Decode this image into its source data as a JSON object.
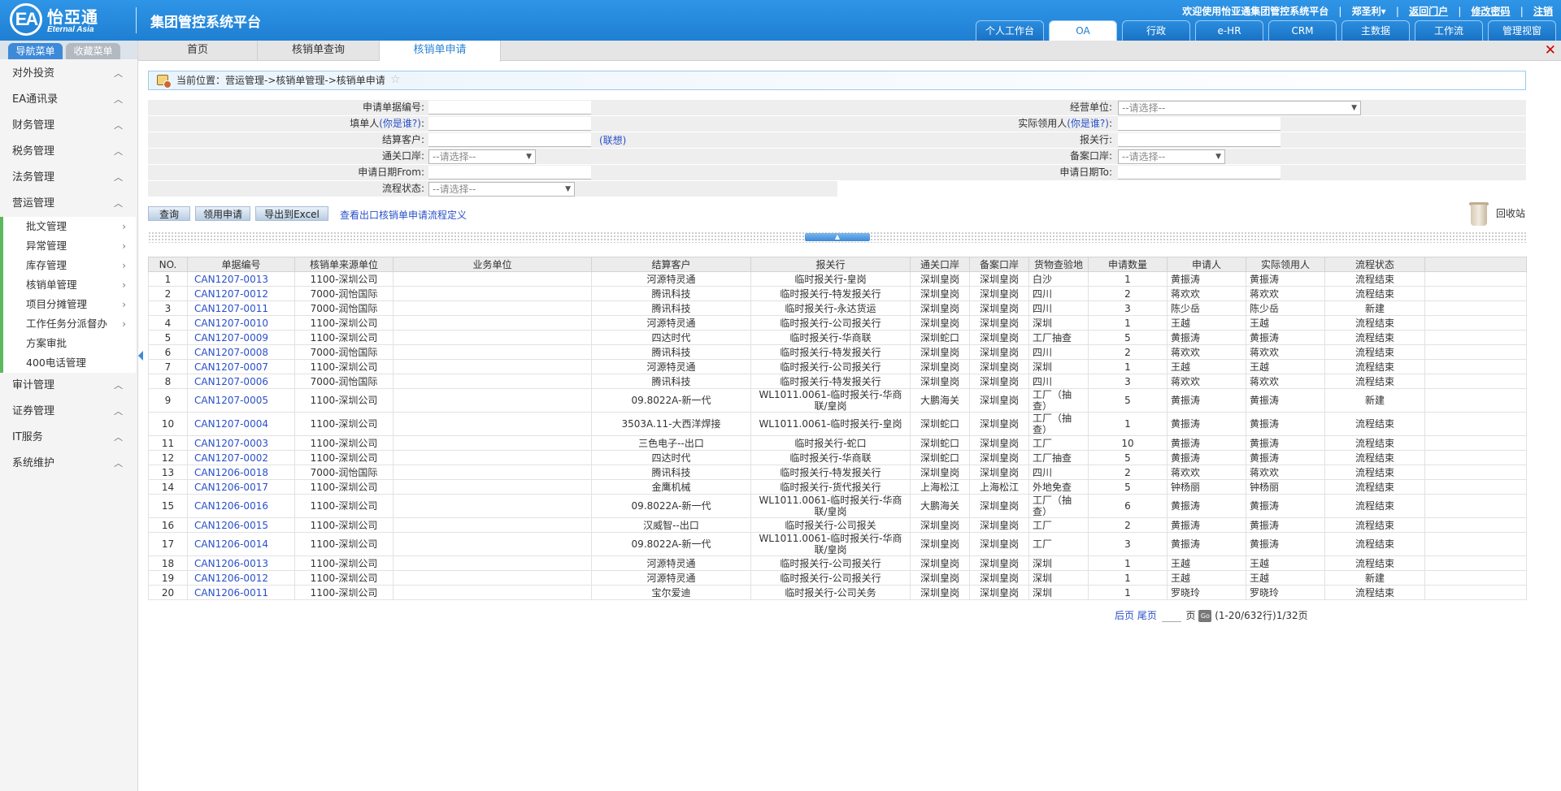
{
  "header": {
    "logo_cn": "怡亞通",
    "logo_en": "Eternal Asia",
    "logo_mark": "EA",
    "system_title": "集团管控系统平台",
    "welcome_text": "欢迎使用怡亚通集团管控系统平台",
    "user_name": "郑圣利▾",
    "links": [
      "返回门户",
      "修改密码",
      "注销"
    ],
    "module_tabs": [
      "个人工作台",
      "OA",
      "行政",
      "e-HR",
      "CRM",
      "主数据",
      "工作流",
      "管理视窗"
    ],
    "active_module": "OA"
  },
  "sidebar": {
    "tabs": [
      "导航菜单",
      "收藏菜单"
    ],
    "groups_top": [
      "对外投资",
      "EA通讯录",
      "财务管理",
      "税务管理",
      "法务管理",
      "营运管理"
    ],
    "sub_items": [
      "批文管理",
      "异常管理",
      "库存管理",
      "核销单管理",
      "项目分摊管理",
      "工作任务分派督办",
      "方案审批",
      "400电话管理"
    ],
    "groups_bottom": [
      "审计管理",
      "证券管理",
      "IT服务",
      "系统维护"
    ]
  },
  "page_tabs": [
    "首页",
    "核销单查询",
    "核销单申请"
  ],
  "breadcrumb": "当前位置：营运管理->核销单管理->核销单申请",
  "form": {
    "left_labels": [
      "申请单据编号:",
      "填单人",
      "结算客户:",
      "通关口岸:",
      "申请日期From:",
      "流程状态:"
    ],
    "who_label": "(你是谁?)",
    "colon": ":",
    "right_labels": [
      "经营单位:",
      "实际领用人",
      "报关行:",
      "备案口岸:",
      "申请日期To:"
    ],
    "select_placeholder": "--请选择--",
    "assoc_link": "(联想)"
  },
  "actions": {
    "query": "查询",
    "apply": "领用申请",
    "export": "导出到Excel",
    "flow_link": "查看出口核销单申请流程定义",
    "recycle": "回收站"
  },
  "table": {
    "headers": [
      "NO.",
      "单据编号",
      "核销单来源单位",
      "业务单位",
      "结算客户",
      "报关行",
      "通关口岸",
      "备案口岸",
      "货物查验地",
      "申请数量",
      "申请人",
      "实际领用人",
      "流程状态",
      ""
    ],
    "rows": [
      [
        "1",
        "CAN1207-0013",
        "1100-深圳公司",
        "",
        "河源特灵通",
        "临时报关行-皇岗",
        "深圳皇岗",
        "深圳皇岗",
        "白沙",
        "1",
        "黄振涛",
        "黄振涛",
        "流程结束",
        ""
      ],
      [
        "2",
        "CAN1207-0012",
        "7000-润怡国际",
        "",
        "腾讯科技",
        "临时报关行-特发报关行",
        "深圳皇岗",
        "深圳皇岗",
        "四川",
        "2",
        "蒋欢欢",
        "蒋欢欢",
        "流程结束",
        ""
      ],
      [
        "3",
        "CAN1207-0011",
        "7000-润怡国际",
        "",
        "腾讯科技",
        "临时报关行-永达货运",
        "深圳皇岗",
        "深圳皇岗",
        "四川",
        "3",
        "陈少岳",
        "陈少岳",
        "新建",
        ""
      ],
      [
        "4",
        "CAN1207-0010",
        "1100-深圳公司",
        "",
        "河源特灵通",
        "临时报关行-公司报关行",
        "深圳皇岗",
        "深圳皇岗",
        "深圳",
        "1",
        "王越",
        "王越",
        "流程结束",
        ""
      ],
      [
        "5",
        "CAN1207-0009",
        "1100-深圳公司",
        "",
        "四达时代",
        "临时报关行-华商联",
        "深圳蛇口",
        "深圳皇岗",
        "工厂抽查",
        "5",
        "黄振涛",
        "黄振涛",
        "流程结束",
        ""
      ],
      [
        "6",
        "CAN1207-0008",
        "7000-润怡国际",
        "",
        "腾讯科技",
        "临时报关行-特发报关行",
        "深圳皇岗",
        "深圳皇岗",
        "四川",
        "2",
        "蒋欢欢",
        "蒋欢欢",
        "流程结束",
        ""
      ],
      [
        "7",
        "CAN1207-0007",
        "1100-深圳公司",
        "",
        "河源特灵通",
        "临时报关行-公司报关行",
        "深圳皇岗",
        "深圳皇岗",
        "深圳",
        "1",
        "王越",
        "王越",
        "流程结束",
        ""
      ],
      [
        "8",
        "CAN1207-0006",
        "7000-润怡国际",
        "",
        "腾讯科技",
        "临时报关行-特发报关行",
        "深圳皇岗",
        "深圳皇岗",
        "四川",
        "3",
        "蒋欢欢",
        "蒋欢欢",
        "流程结束",
        ""
      ],
      [
        "9",
        "CAN1207-0005",
        "1100-深圳公司",
        "",
        "09.8022A-新一代",
        "WL1011.0061-临时报关行-华商联/皇岗",
        "大鹏海关",
        "深圳皇岗",
        "工厂（抽查）",
        "5",
        "黄振涛",
        "黄振涛",
        "新建",
        ""
      ],
      [
        "10",
        "CAN1207-0004",
        "1100-深圳公司",
        "",
        "3503A.11-大西洋焊接",
        "WL1011.0061-临时报关行-皇岗",
        "深圳蛇口",
        "深圳皇岗",
        "工厂（抽查）",
        "1",
        "黄振涛",
        "黄振涛",
        "流程结束",
        ""
      ],
      [
        "11",
        "CAN1207-0003",
        "1100-深圳公司",
        "",
        "三色电子--出口",
        "临时报关行-蛇口",
        "深圳蛇口",
        "深圳皇岗",
        "工厂",
        "10",
        "黄振涛",
        "黄振涛",
        "流程结束",
        ""
      ],
      [
        "12",
        "CAN1207-0002",
        "1100-深圳公司",
        "",
        "四达时代",
        "临时报关行-华商联",
        "深圳蛇口",
        "深圳皇岗",
        "工厂抽查",
        "5",
        "黄振涛",
        "黄振涛",
        "流程结束",
        ""
      ],
      [
        "13",
        "CAN1206-0018",
        "7000-润怡国际",
        "",
        "腾讯科技",
        "临时报关行-特发报关行",
        "深圳皇岗",
        "深圳皇岗",
        "四川",
        "2",
        "蒋欢欢",
        "蒋欢欢",
        "流程结束",
        ""
      ],
      [
        "14",
        "CAN1206-0017",
        "1100-深圳公司",
        "",
        "金鹰机械",
        "临时报关行-货代报关行",
        "上海松江",
        "上海松江",
        "外地免查",
        "5",
        "钟杨丽",
        "钟杨丽",
        "流程结束",
        ""
      ],
      [
        "15",
        "CAN1206-0016",
        "1100-深圳公司",
        "",
        "09.8022A-新一代",
        "WL1011.0061-临时报关行-华商联/皇岗",
        "大鹏海关",
        "深圳皇岗",
        "工厂（抽查）",
        "6",
        "黄振涛",
        "黄振涛",
        "流程结束",
        ""
      ],
      [
        "16",
        "CAN1206-0015",
        "1100-深圳公司",
        "",
        "汉威智--出口",
        "临时报关行-公司报关",
        "深圳皇岗",
        "深圳皇岗",
        "工厂",
        "2",
        "黄振涛",
        "黄振涛",
        "流程结束",
        ""
      ],
      [
        "17",
        "CAN1206-0014",
        "1100-深圳公司",
        "",
        "09.8022A-新一代",
        "WL1011.0061-临时报关行-华商联/皇岗",
        "深圳皇岗",
        "深圳皇岗",
        "工厂",
        "3",
        "黄振涛",
        "黄振涛",
        "流程结束",
        ""
      ],
      [
        "18",
        "CAN1206-0013",
        "1100-深圳公司",
        "",
        "河源特灵通",
        "临时报关行-公司报关行",
        "深圳皇岗",
        "深圳皇岗",
        "深圳",
        "1",
        "王越",
        "王越",
        "流程结束",
        ""
      ],
      [
        "19",
        "CAN1206-0012",
        "1100-深圳公司",
        "",
        "河源特灵通",
        "临时报关行-公司报关行",
        "深圳皇岗",
        "深圳皇岗",
        "深圳",
        "1",
        "王越",
        "王越",
        "新建",
        ""
      ],
      [
        "20",
        "CAN1206-0011",
        "1100-深圳公司",
        "",
        "宝尔爱迪",
        "临时报关行-公司关务",
        "深圳皇岗",
        "深圳皇岗",
        "深圳",
        "1",
        "罗晓玲",
        "罗晓玲",
        "流程结束",
        ""
      ]
    ]
  },
  "pager": {
    "prev": "后页",
    "last": "尾页",
    "page_unit": "页",
    "go": "Go",
    "summary": "(1-20/632行)1/32页"
  }
}
